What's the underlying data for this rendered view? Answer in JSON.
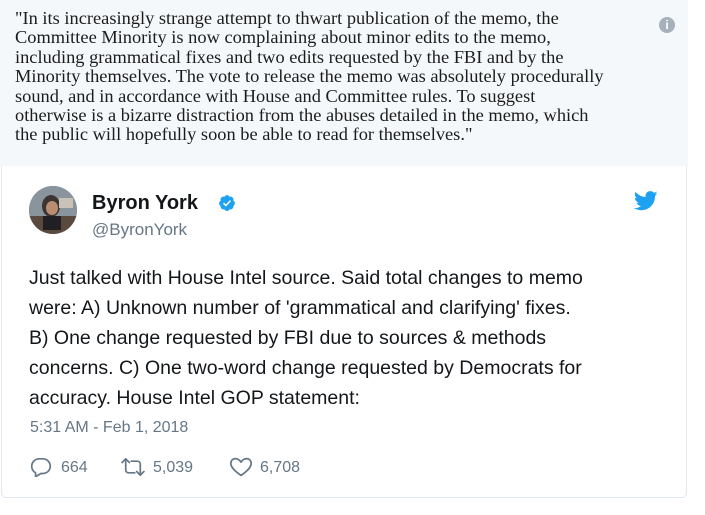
{
  "quote": {
    "text": "\"In its increasingly strange attempt to thwart publication of the memo, the\nCommittee Minority is now complaining about minor edits to the memo,\nincluding grammatical fixes and two edits requested by the FBI and by the\nMinority themselves. The vote to release the memo was absolutely procedurally\nsound, and in accordance with House and Committee rules. To suggest\notherwise is a bizarre distraction from the abuses detailed in the memo, which\nthe public will hopefully soon be able to read for themselves.\"",
    "info_icon": "info-icon",
    "info_glyph": "i"
  },
  "tweet": {
    "display_name": "Byron York",
    "handle": "@ByronYork",
    "verified_icon": "verified-badge-icon",
    "platform_icon": "twitter-bird-icon",
    "text": "Just talked with House Intel source. Said total changes to memo\nwere: A) Unknown number of 'grammatical and clarifying' fixes.\nB) One change requested by FBI due to sources & methods\nconcerns. C) One two-word change requested by Democrats for\naccuracy. House Intel GOP statement:",
    "timestamp": "5:31 AM - Feb 1, 2018",
    "actions": {
      "replies": "664",
      "retweets": "5,039",
      "likes": "6,708"
    }
  },
  "colors": {
    "quote_background": "#f5f8fa",
    "twitter_blue": "#1da1f2",
    "secondary_text": "#657786",
    "primary_text": "#14171a"
  }
}
